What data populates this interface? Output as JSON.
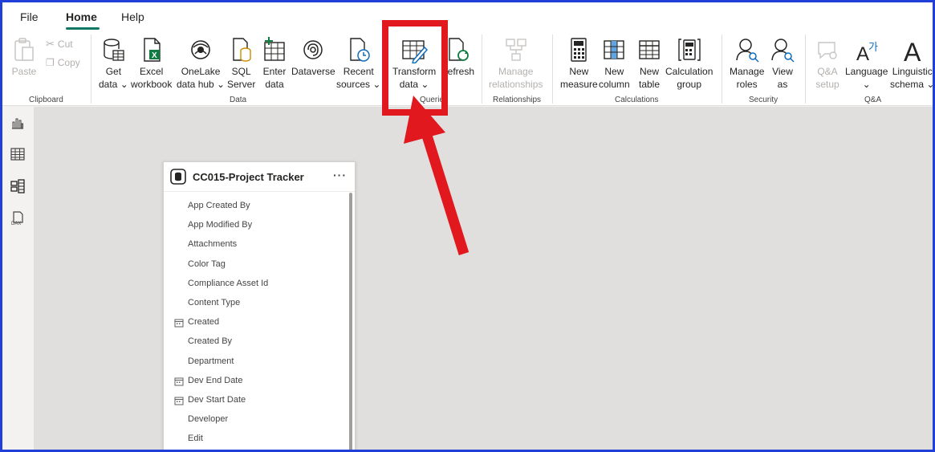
{
  "menu": {
    "tabs": [
      {
        "label": "File"
      },
      {
        "label": "Home"
      },
      {
        "label": "Help"
      }
    ]
  },
  "ribbon": {
    "clipboard": {
      "paste": "Paste",
      "cut": "Cut",
      "copy": "Copy",
      "group_label": "Clipboard"
    },
    "data": {
      "get_data": [
        "Get",
        "data ⌄"
      ],
      "excel": [
        "Excel",
        "workbook"
      ],
      "onelake": [
        "OneLake",
        "data hub ⌄"
      ],
      "sql": [
        "SQL",
        "Server"
      ],
      "enter_data": [
        "Enter",
        "data"
      ],
      "dataverse": "Dataverse",
      "recent": [
        "Recent",
        "sources ⌄"
      ],
      "group_label": "Data"
    },
    "queries": {
      "transform": [
        "Transform",
        "data ⌄"
      ],
      "refresh": "Refresh",
      "group_label": "Queries"
    },
    "relationships": {
      "manage": [
        "Manage",
        "relationships"
      ],
      "group_label": "Relationships"
    },
    "calculations": {
      "new_measure": [
        "New",
        "measure"
      ],
      "new_column": [
        "New",
        "column"
      ],
      "new_table": [
        "New",
        "table"
      ],
      "calc_group": [
        "Calculation",
        "group"
      ],
      "group_label": "Calculations"
    },
    "security": {
      "manage_roles": [
        "Manage",
        "roles"
      ],
      "view_as": [
        "View",
        "as"
      ],
      "group_label": "Security"
    },
    "qa": {
      "qa_setup": [
        "Q&A",
        "setup"
      ],
      "language": [
        "Language",
        "⌄"
      ],
      "linguistic": [
        "Linguistic",
        "schema ⌄"
      ],
      "group_label": "Q&A"
    }
  },
  "table_card": {
    "title": "CC015-Project Tracker",
    "more": "···",
    "fields": [
      {
        "name": "App Created By",
        "icon": ""
      },
      {
        "name": "App Modified By",
        "icon": ""
      },
      {
        "name": "Attachments",
        "icon": ""
      },
      {
        "name": "Color Tag",
        "icon": ""
      },
      {
        "name": "Compliance Asset Id",
        "icon": ""
      },
      {
        "name": "Content Type",
        "icon": ""
      },
      {
        "name": "Created",
        "icon": "calendar-icon"
      },
      {
        "name": "Created By",
        "icon": ""
      },
      {
        "name": "Department",
        "icon": ""
      },
      {
        "name": "Dev End Date",
        "icon": "calendar-icon"
      },
      {
        "name": "Dev Start Date",
        "icon": "calendar-icon"
      },
      {
        "name": "Developer",
        "icon": ""
      },
      {
        "name": "Edit",
        "icon": ""
      }
    ]
  },
  "colors": {
    "accent": "#117865",
    "annotation": "#e1191f",
    "frame": "#1f3fd8"
  }
}
